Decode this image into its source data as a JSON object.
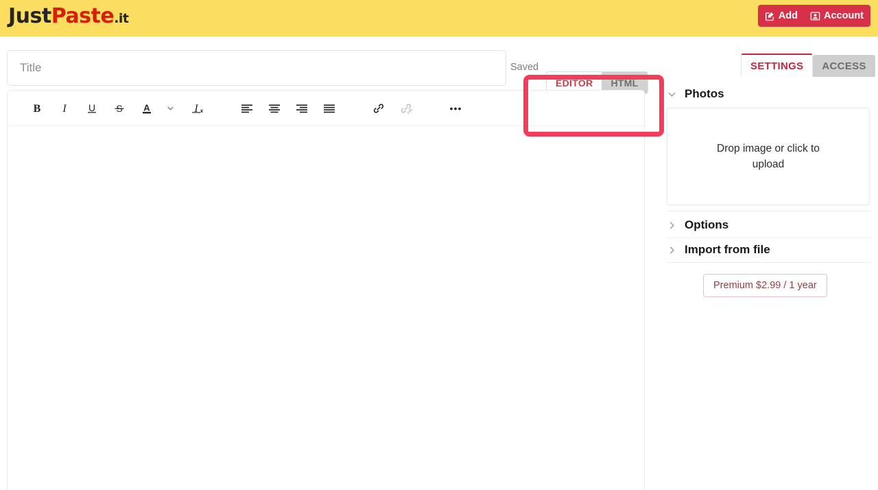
{
  "header": {
    "logo": {
      "part1": "Just",
      "part2": "Paste",
      "part3": ".it"
    },
    "actions": [
      {
        "label": "Add",
        "icon": "edit-square-icon"
      },
      {
        "label": "Account",
        "icon": "user-card-icon"
      }
    ]
  },
  "editor": {
    "title_placeholder": "Title",
    "title_value": "",
    "saved_status": "Saved",
    "mode_tabs": [
      {
        "label": "EDITOR",
        "active": true
      },
      {
        "label": "HTML",
        "active": false
      }
    ],
    "toolbar": [
      {
        "name": "bold-icon",
        "label": "B"
      },
      {
        "name": "italic-icon",
        "label": "I"
      },
      {
        "name": "underline-icon",
        "label": "U"
      },
      {
        "name": "strikethrough-icon",
        "label": "S"
      },
      {
        "name": "text-color-icon",
        "label": "A"
      },
      {
        "name": "chevron-down-icon",
        "label": ""
      },
      {
        "name": "clear-formatting-icon",
        "label": "Tx"
      },
      {
        "name": "align-left-icon",
        "label": ""
      },
      {
        "name": "align-center-icon",
        "label": ""
      },
      {
        "name": "align-right-icon",
        "label": ""
      },
      {
        "name": "align-justify-icon",
        "label": ""
      },
      {
        "name": "link-icon",
        "label": ""
      },
      {
        "name": "unlink-icon",
        "label": ""
      },
      {
        "name": "more-options-icon",
        "label": ""
      }
    ],
    "body_text": ""
  },
  "sidebar": {
    "tabs": [
      {
        "label": "SETTINGS",
        "active": true
      },
      {
        "label": "ACCESS",
        "active": false
      }
    ],
    "sections": [
      {
        "label": "Photos",
        "expanded": true
      },
      {
        "label": "Options",
        "expanded": false
      },
      {
        "label": "Import from file",
        "expanded": false
      }
    ],
    "photo_drop_text": "Drop image or click to upload",
    "premium_label": "Premium $2.99 / 1 year"
  },
  "colors": {
    "header_yellow": "#FBDE5F",
    "brand_red": "#D81E05",
    "action_red": "#D9304A",
    "tab_active_red": "#C7263E",
    "annotation_pink": "#F43D5C"
  }
}
